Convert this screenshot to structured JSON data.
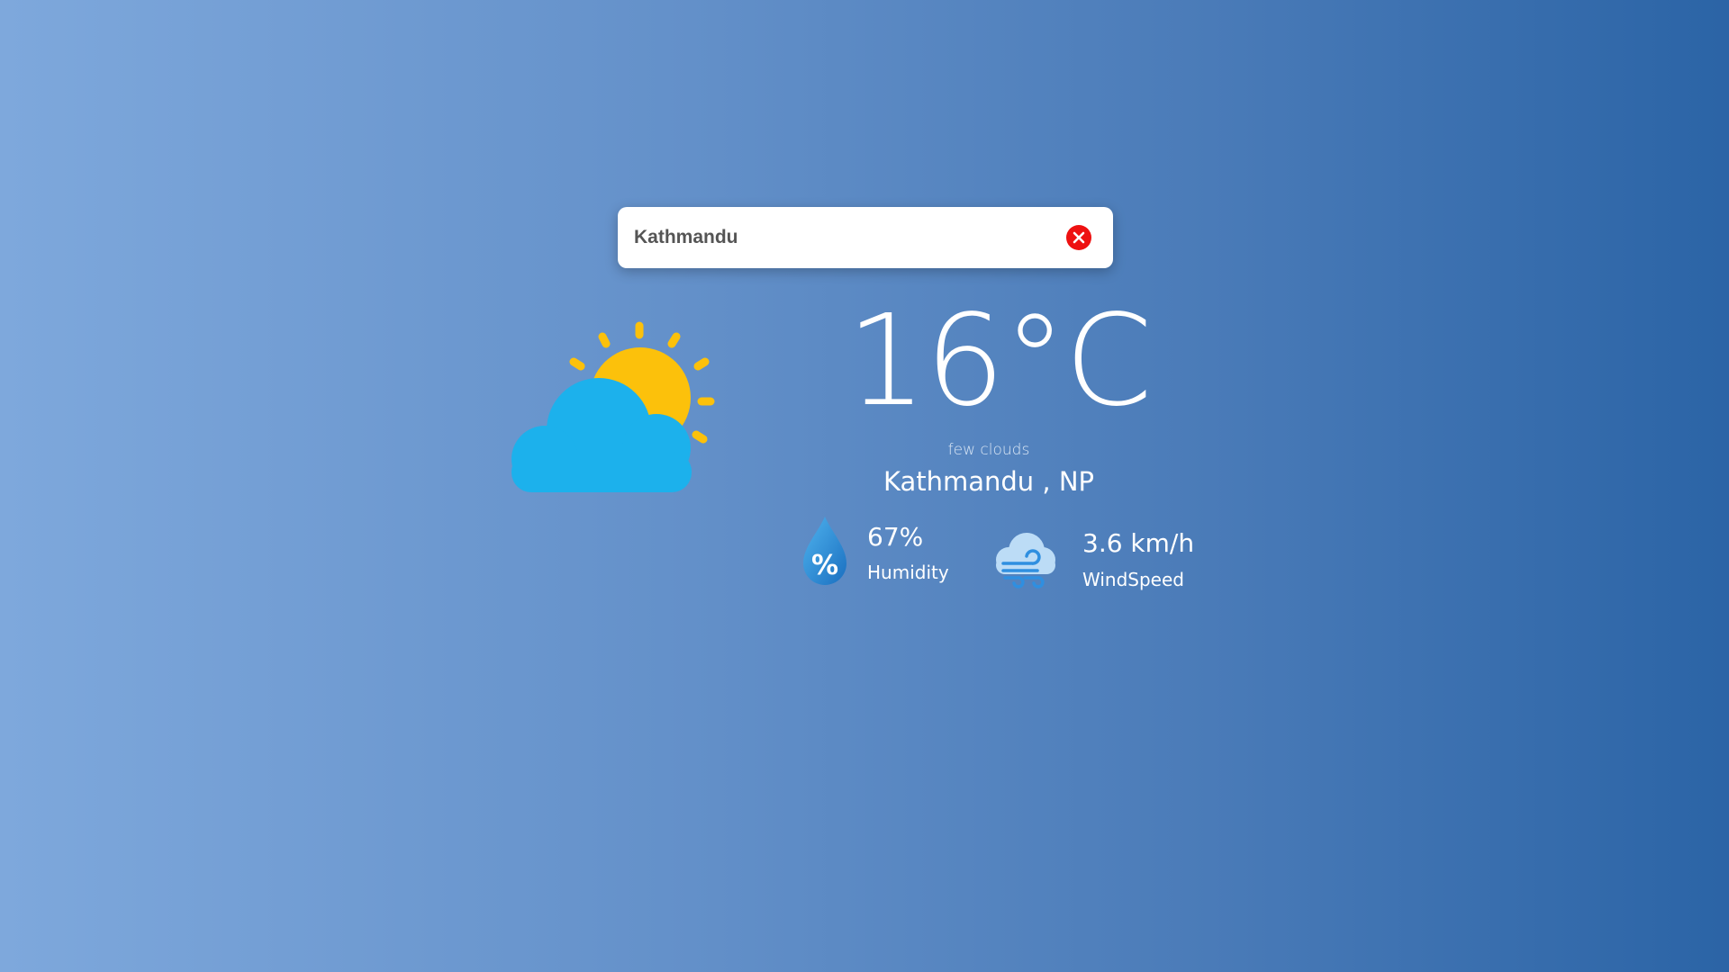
{
  "search": {
    "value": "Kathmandu",
    "clear_icon": "close-circle-icon"
  },
  "weather": {
    "icon": "partly-cloudy-icon",
    "temperature": "16°C",
    "description": "few clouds",
    "location": "Kathmandu , NP"
  },
  "details": {
    "humidity": {
      "icon": "humidity-drop-icon",
      "value": "67%",
      "label": "Humidity"
    },
    "wind": {
      "icon": "wind-cloud-icon",
      "value": "3.6 km/h",
      "label": "WindSpeed"
    }
  },
  "colors": {
    "gradient_start": "#7ea8dc",
    "gradient_end": "#2b64a6",
    "sun": "#fcc10b",
    "cloud": "#1cb1ec",
    "clear_button": "#ee1111"
  }
}
